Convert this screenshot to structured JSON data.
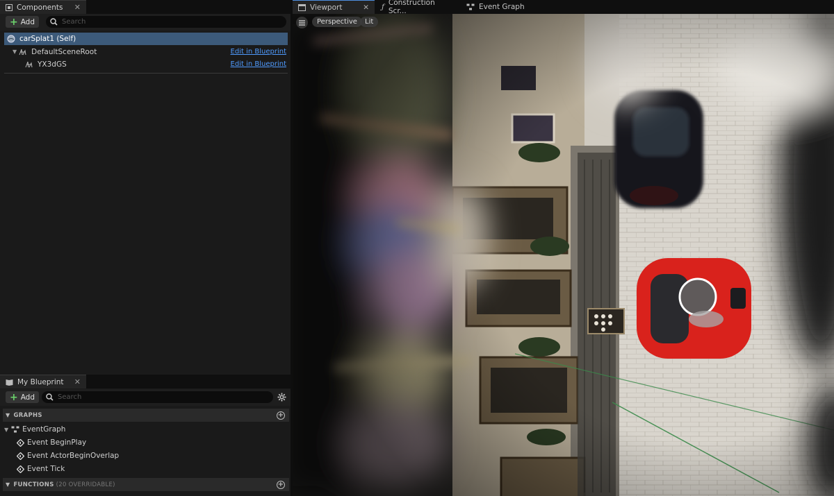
{
  "components_panel": {
    "tab_label": "Components",
    "add_label": "Add",
    "search_placeholder": "Search",
    "tree": [
      {
        "label": "carSplat1 (Self)",
        "action": ""
      },
      {
        "label": "DefaultSceneRoot",
        "action": "Edit in Blueprint"
      },
      {
        "label": "YX3dGS",
        "action": "Edit in Blueprint"
      }
    ]
  },
  "blueprint_panel": {
    "tab_label": "My Blueprint",
    "add_label": "Add",
    "search_placeholder": "Search",
    "graphs_header": "GRAPHS",
    "event_graph": "EventGraph",
    "events": [
      "Event BeginPlay",
      "Event ActorBeginOverlap",
      "Event Tick"
    ],
    "functions_header": "FUNCTIONS",
    "functions_sub": "(20 OVERRIDABLE)"
  },
  "editor_tabs": [
    "Viewport",
    "Construction Scr...",
    "Event Graph"
  ],
  "viewport": {
    "perspective_label": "Perspective",
    "lit_label": "Lit"
  },
  "colors": {
    "accent": "#4f8fe0",
    "selection": "#3c5a7a",
    "link": "#4f9bff",
    "add_plus": "#6bd16b"
  }
}
